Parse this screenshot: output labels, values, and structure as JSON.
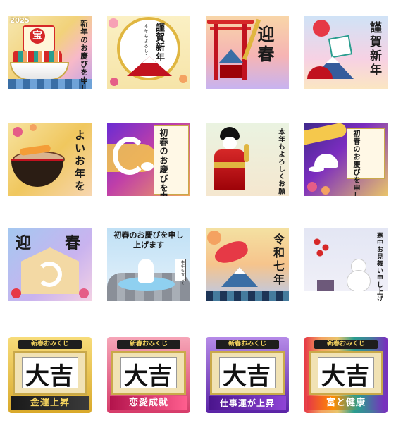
{
  "stickers": {
    "s1": {
      "year": "2025",
      "sail": "宝",
      "text": "新年のお慶びを申し上げます"
    },
    "s2": {
      "title": "謹賀新年",
      "sub": "本年もよろしくお願い致します"
    },
    "s3": {
      "text": "迎春"
    },
    "s4": {
      "text": "謹賀新年"
    },
    "s5": {
      "text": "よいお年を"
    },
    "s6": {
      "text": "初春のお慶びを申し上げます"
    },
    "s7": {
      "text": "本年もよろしくお願い致します"
    },
    "s8": {
      "text": "初春のお慶びを申し上げます"
    },
    "s9": {
      "left": "迎",
      "right": "春"
    },
    "s10": {
      "text": "初春のお慶びを申し上げます",
      "sign": "本年も宜しく"
    },
    "s11": {
      "text": "令和七年"
    },
    "s12": {
      "text": "寒中お見舞い申し上げます"
    }
  },
  "omikuji": [
    {
      "header": "新春おみくじ",
      "result": "大吉",
      "fortune": "金運上昇",
      "color": "#f2c14e"
    },
    {
      "header": "新春おみくじ",
      "result": "大吉",
      "fortune": "恋愛成就",
      "color": "#e8557a"
    },
    {
      "header": "新春おみくじ",
      "result": "大吉",
      "fortune": "仕事運が上昇",
      "color": "#7a3cc9"
    },
    {
      "header": "新春おみくじ",
      "result": "大吉",
      "fortune": "富と健康",
      "color": "#ff7a00"
    }
  ],
  "colors": {
    "gold": "#e9c46a",
    "red": "#d62828",
    "navy": "#1d3557",
    "purple": "#7b2cbf"
  }
}
